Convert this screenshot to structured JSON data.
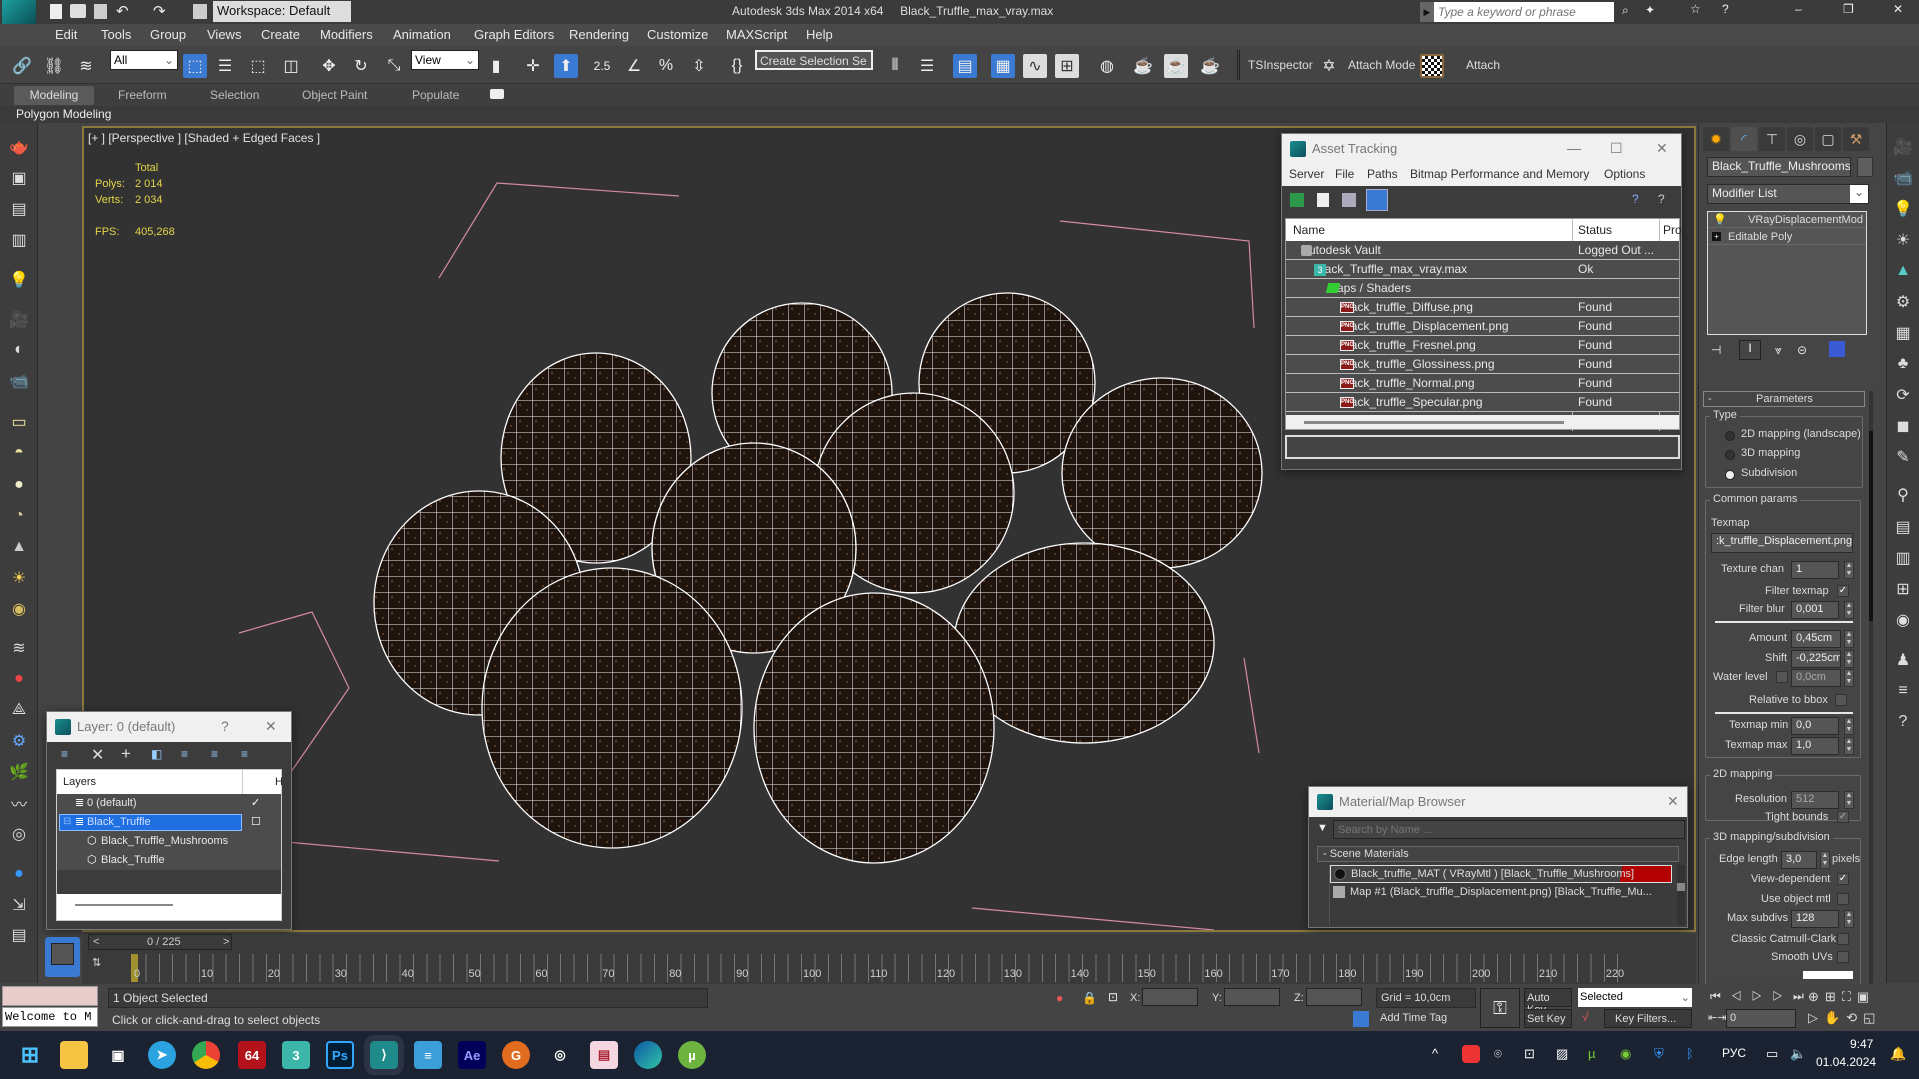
{
  "titlebar": {
    "app_title": "Autodesk 3ds Max  2014 x64",
    "file_name": "Black_Truffle_max_vray.max",
    "workspace": "Workspace: Default",
    "search_placeholder": "Type a keyword or phrase"
  },
  "menu": [
    "Edit",
    "Tools",
    "Group",
    "Views",
    "Create",
    "Modifiers",
    "Animation",
    "Graph Editors",
    "Rendering",
    "Customize",
    "MAXScript",
    "Help"
  ],
  "toolbar": {
    "selection_filter": "All",
    "ref_coord": "View",
    "snap_value": "2.5",
    "named_selection": "Create Selection Se",
    "tsinspector": "TSInspector",
    "attach_mode": "Attach Mode",
    "attach": "Attach"
  },
  "ribbon": {
    "tabs": [
      "Modeling",
      "Freeform",
      "Selection",
      "Object Paint",
      "Populate"
    ],
    "active_tab": "Modeling",
    "panel_label": "Polygon Modeling"
  },
  "viewport": {
    "label": "[+ ] [Perspective ] [Shaded + Edged Faces ]",
    "stats": {
      "header": "Total",
      "polys_label": "Polys:",
      "polys": "2 014",
      "verts_label": "Verts:",
      "verts": "2 034",
      "fps_label": "FPS:",
      "fps": "405,268"
    }
  },
  "asset_tracking": {
    "title": "Asset Tracking",
    "menu": [
      "Server",
      "File",
      "Paths",
      "Bitmap Performance and Memory",
      "Options"
    ],
    "columns": [
      "Name",
      "Status",
      "Pro"
    ],
    "rows": [
      {
        "name": "Autodesk Vault",
        "status": "Logged Out ...",
        "indent": 1,
        "icon": "vault"
      },
      {
        "name": "Black_Truffle_max_vray.max",
        "status": "Ok",
        "indent": 2,
        "icon": "max"
      },
      {
        "name": "Maps / Shaders",
        "status": "",
        "indent": 3,
        "icon": "maps"
      },
      {
        "name": "Black_truffle_Diffuse.png",
        "status": "Found",
        "indent": 4,
        "icon": "png"
      },
      {
        "name": "Black_truffle_Displacement.png",
        "status": "Found",
        "indent": 4,
        "icon": "png"
      },
      {
        "name": "Black_truffle_Fresnel.png",
        "status": "Found",
        "indent": 4,
        "icon": "png"
      },
      {
        "name": "Black_truffle_Glossiness.png",
        "status": "Found",
        "indent": 4,
        "icon": "png"
      },
      {
        "name": "Black_truffle_Normal.png",
        "status": "Found",
        "indent": 4,
        "icon": "png"
      },
      {
        "name": "Black_truffle_Specular.png",
        "status": "Found",
        "indent": 4,
        "icon": "png"
      }
    ]
  },
  "command_panel": {
    "object_name": "Black_Truffle_Mushrooms",
    "modifier_list": "Modifier List",
    "stack": [
      "VRayDisplacementMod",
      "Editable Poly"
    ],
    "rollout_title": "Parameters",
    "type_group": "Type",
    "type_options": [
      "2D mapping (landscape)",
      "3D mapping",
      "Subdivision"
    ],
    "type_selected": "Subdivision",
    "common_group": "Common params",
    "texmap_label": "Texmap",
    "texmap_value": ":k_truffle_Displacement.png)",
    "texture_chan_label": "Texture chan",
    "texture_chan": "1",
    "filter_texmap_label": "Filter texmap",
    "filter_texmap": true,
    "filter_blur_label": "Filter blur",
    "filter_blur": "0,001",
    "amount_label": "Amount",
    "amount": "0,45cm",
    "shift_label": "Shift",
    "shift": "-0,225cm",
    "water_level_label": "Water level",
    "water_level_enabled": false,
    "water_level": "0,0cm",
    "relative_bbox_label": "Relative to bbox",
    "relative_bbox": false,
    "texmap_min_label": "Texmap min",
    "texmap_min": "0,0",
    "texmap_max_label": "Texmap max",
    "texmap_max": "1,0",
    "mapping2d_group": "2D mapping",
    "resolution_label": "Resolution",
    "resolution": "512",
    "tight_bounds_label": "Tight bounds",
    "tight_bounds": true,
    "mapping3d_group": "3D mapping/subdivision",
    "edge_length_label": "Edge length",
    "edge_length": "3,0",
    "edge_length_unit": "pixels",
    "view_dependent_label": "View-dependent",
    "view_dependent": true,
    "use_object_mtl_label": "Use object mtl",
    "use_object_mtl": false,
    "max_subdivs_label": "Max subdivs",
    "max_subdivs": "128",
    "catmull_label": "Classic Catmull-Clark",
    "catmull": false,
    "smooth_uvs_label": "Smooth UVs",
    "smooth_uvs": false
  },
  "layer_dialog": {
    "title": "Layer: 0 (default)",
    "help": "?",
    "column": "Layers",
    "column2": "H",
    "rows": [
      {
        "name": "0 (default)",
        "indent": 1,
        "selected": false,
        "icon": "layer",
        "check": "✓"
      },
      {
        "name": "Black_Truffle",
        "indent": 1,
        "selected": true,
        "icon": "layer",
        "check": "☐"
      },
      {
        "name": "Black_Truffle_Mushrooms",
        "indent": 2,
        "selected": false,
        "icon": "object",
        "check": ""
      },
      {
        "name": "Black_Truffle",
        "indent": 2,
        "selected": false,
        "icon": "object",
        "check": ""
      }
    ]
  },
  "material_browser": {
    "title": "Material/Map Browser",
    "search_placeholder": "Search by Name ...",
    "section": "- Scene Materials",
    "items": [
      "Black_truffle_MAT  ( VRayMtl )  [Black_Truffle_Mushrooms]",
      "Map #1 (Black_truffle_Displacement.png) [Black_Truffle_Mu..."
    ]
  },
  "timeline": {
    "frame": "0 / 225",
    "ticks": [
      "0",
      "10",
      "20",
      "30",
      "40",
      "50",
      "60",
      "70",
      "80",
      "90",
      "100",
      "110",
      "120",
      "130",
      "140",
      "150",
      "160",
      "170",
      "180",
      "190",
      "200",
      "210",
      "220"
    ]
  },
  "status": {
    "maxscript": "Welcome to M",
    "selection": "1 Object Selected",
    "prompt": "Click or click-and-drag to select objects",
    "x_label": "X:",
    "y_label": "Y:",
    "z_label": "Z:",
    "grid": "Grid = 10,0cm",
    "add_time_tag": "Add Time Tag",
    "auto_key": "Auto Key",
    "set_key": "Set Key",
    "key_mode": "Selected",
    "key_filters": "Key Filters...",
    "current_frame": "0"
  },
  "taskbar": {
    "apps": [
      "start",
      "file-explorer",
      "task-view",
      "telegram",
      "chrome",
      "aida64",
      "3ds-max-2014",
      "photoshop",
      "3ds-max",
      "notepad",
      "after-effects",
      "topaz-gigapixel",
      "obs",
      "floppy-app",
      "edge",
      "utorrent"
    ],
    "lang": "РУС",
    "time": "9:47",
    "date": "01.04.2024"
  },
  "colors": {
    "accent": "#3b7ad3",
    "stat_yellow": "#e3d44a",
    "selection_red": "#b30000",
    "viewport_bg": "#323232"
  }
}
